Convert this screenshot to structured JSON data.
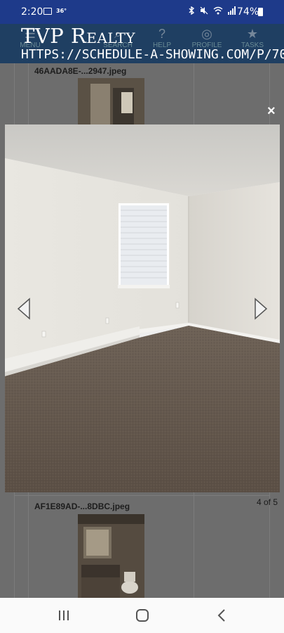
{
  "status_bar": {
    "time": "2:20",
    "temperature": "36°",
    "battery": "74%",
    "icons": [
      "photo-icon",
      "bluetooth-icon",
      "mute-icon",
      "wifi-icon",
      "signal-icon",
      "battery-icon"
    ]
  },
  "app_header": {
    "brand": "TVP Realty",
    "url": "HTTPS://SCHEDULE-A-SHOWING.COM/P/70",
    "nav": [
      {
        "label": "MENU",
        "icon": "menu-icon"
      },
      {
        "label": "SEARCH",
        "icon": "search-icon"
      },
      {
        "label": "HELP",
        "icon": "help-icon"
      },
      {
        "label": "PROFILE",
        "icon": "profile-icon"
      },
      {
        "label": "TASKS",
        "icon": "star-icon"
      }
    ]
  },
  "gallery": {
    "files": [
      {
        "name": "46AADA8E-...2947.jpeg"
      },
      {
        "name": "AF1E89AD-...8DBC.jpeg"
      }
    ]
  },
  "lightbox": {
    "close_label": "×",
    "counter": "4 of 5"
  },
  "colors": {
    "status_bar": "#1e3a8a",
    "header": "#1f3f62",
    "overlay": "#6d6d6d"
  },
  "nav_bar": {
    "buttons": [
      "recents-icon",
      "home-icon",
      "back-icon"
    ]
  }
}
